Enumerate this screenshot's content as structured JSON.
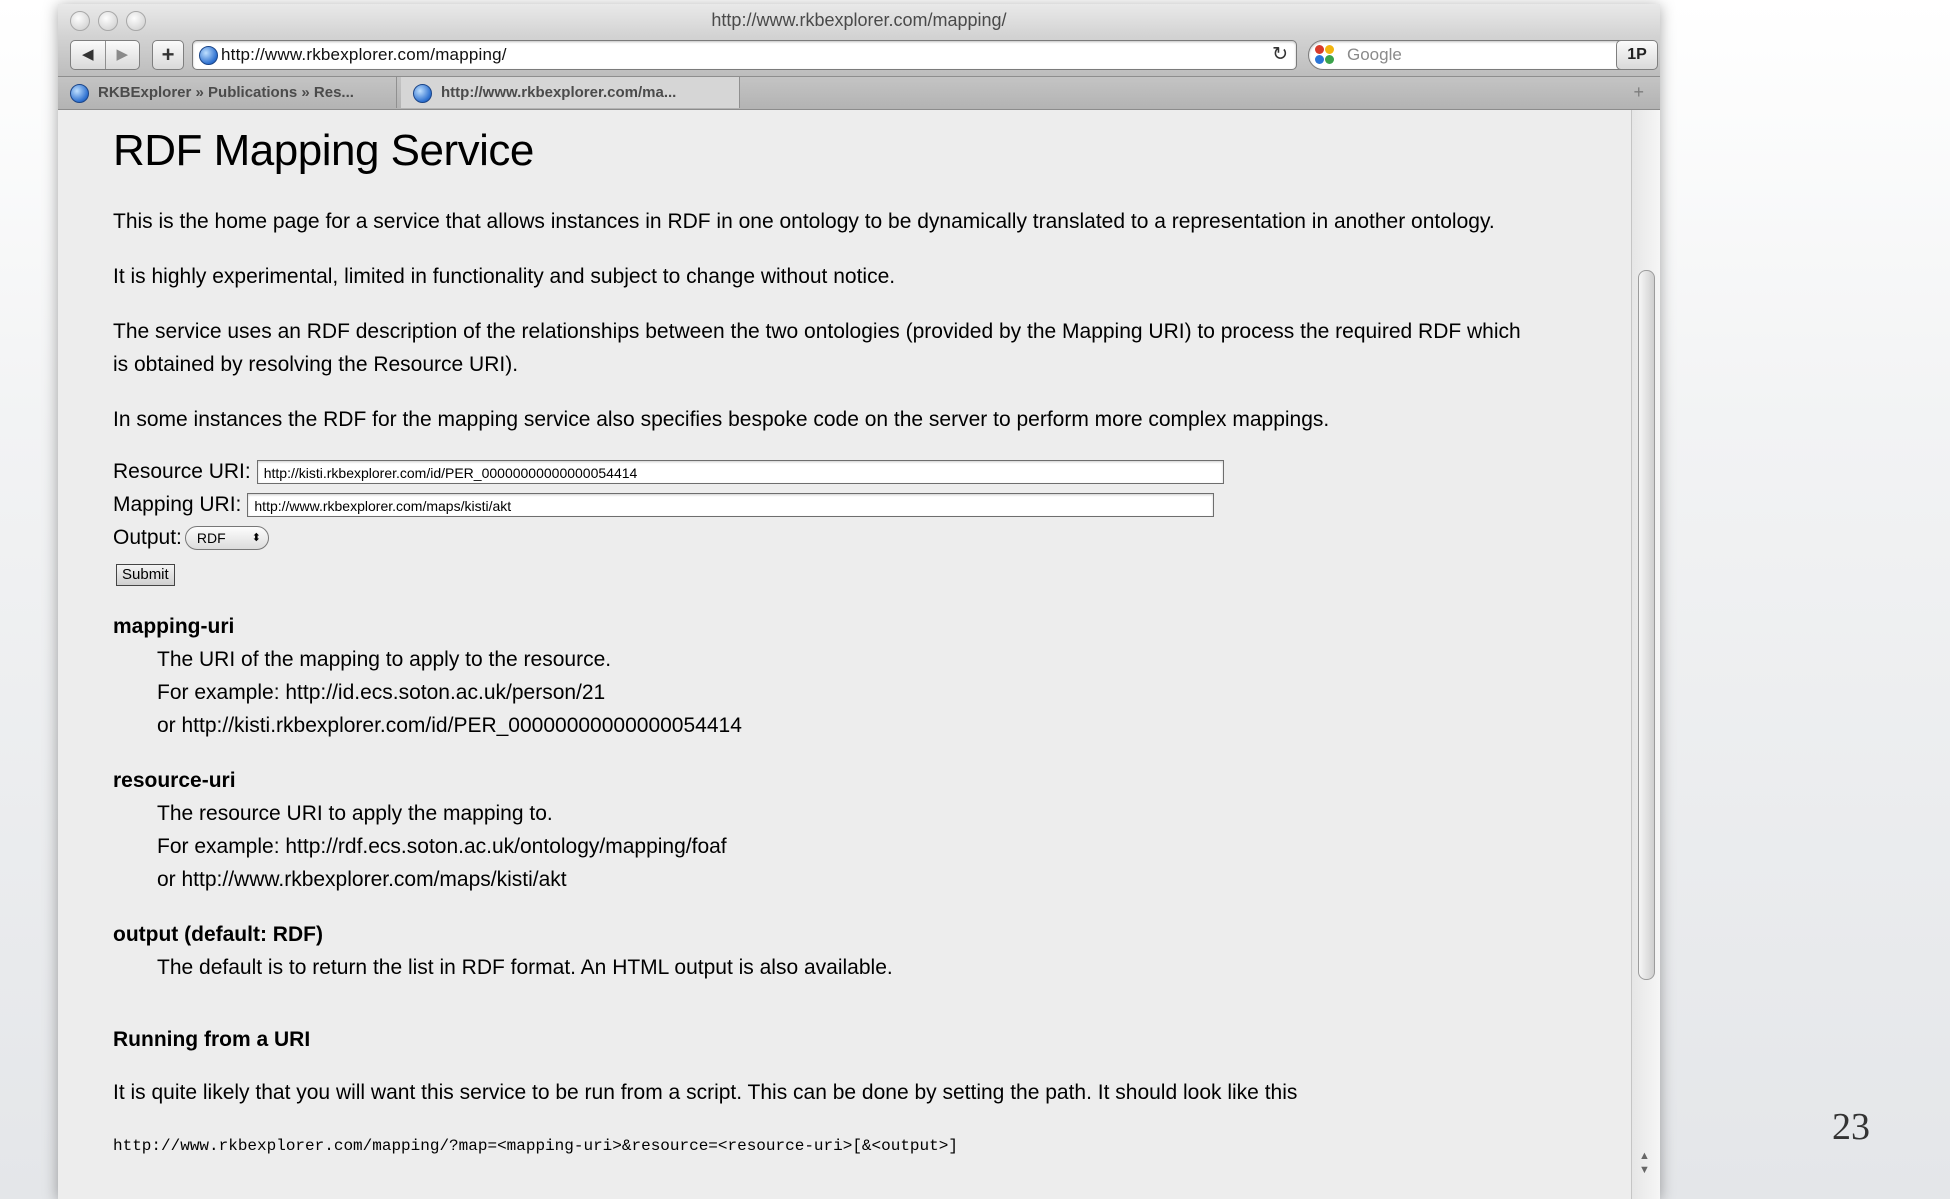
{
  "window": {
    "title": "http://www.rkbexplorer.com/mapping/"
  },
  "toolbar": {
    "back_label": "◀",
    "forward_label": "▶",
    "new_tab_label": "+",
    "url": "http://www.rkbexplorer.com/mapping/",
    "reload_label": "↻",
    "search_placeholder": "Google",
    "onepassword_label": "1P"
  },
  "tabs": [
    {
      "label": "RKBExplorer » Publications » Res..."
    },
    {
      "label": "http://www.rkbexplorer.com/ma..."
    }
  ],
  "tabbar": {
    "add_label": "+"
  },
  "page": {
    "title": "RDF Mapping Service",
    "intro": [
      "This is the home page for a service that allows instances in RDF in one ontology to be dynamically translated to a representation in another ontology.",
      "It is highly experimental, limited in functionality and subject to change without notice.",
      "The service uses an RDF description of the relationships between the two ontologies (provided by the Mapping URI) to process the required RDF which",
      "is obtained by resolving the Resource URI).",
      "In some instances the RDF for the mapping service also specifies bespoke code on the server to perform more complex mappings."
    ],
    "form": {
      "resource_label": "Resource URI:",
      "resource_value": "http://kisti.rkbexplorer.com/id/PER_00000000000000054414",
      "mapping_label": "Mapping URI:",
      "mapping_value": "http://www.rkbexplorer.com/maps/kisti/akt",
      "output_label": "Output:",
      "output_value": "RDF",
      "submit_label": "Submit"
    },
    "definitions": [
      {
        "term": "mapping-uri",
        "lines": [
          "The URI of the mapping to apply to the resource.",
          "For example: http://id.ecs.soton.ac.uk/person/21",
          "or http://kisti.rkbexplorer.com/id/PER_00000000000000054414"
        ]
      },
      {
        "term": "resource-uri",
        "lines": [
          "The resource URI to apply the mapping to.",
          "For example: http://rdf.ecs.soton.ac.uk/ontology/mapping/foaf",
          "or http://www.rkbexplorer.com/maps/kisti/akt"
        ]
      },
      {
        "term": "output (default: RDF)",
        "lines": [
          "The default is to return the list in RDF format. An HTML output is also available."
        ]
      }
    ],
    "running_heading": "Running from a URI",
    "running_text": "It is quite likely that you will want this service to be run from a script. This can be done by setting the path. It should look like this",
    "running_example": "http://www.rkbexplorer.com/mapping/?map=<mapping-uri>&resource=<resource-uri>[&<output>]"
  },
  "slide": {
    "number": "23"
  }
}
